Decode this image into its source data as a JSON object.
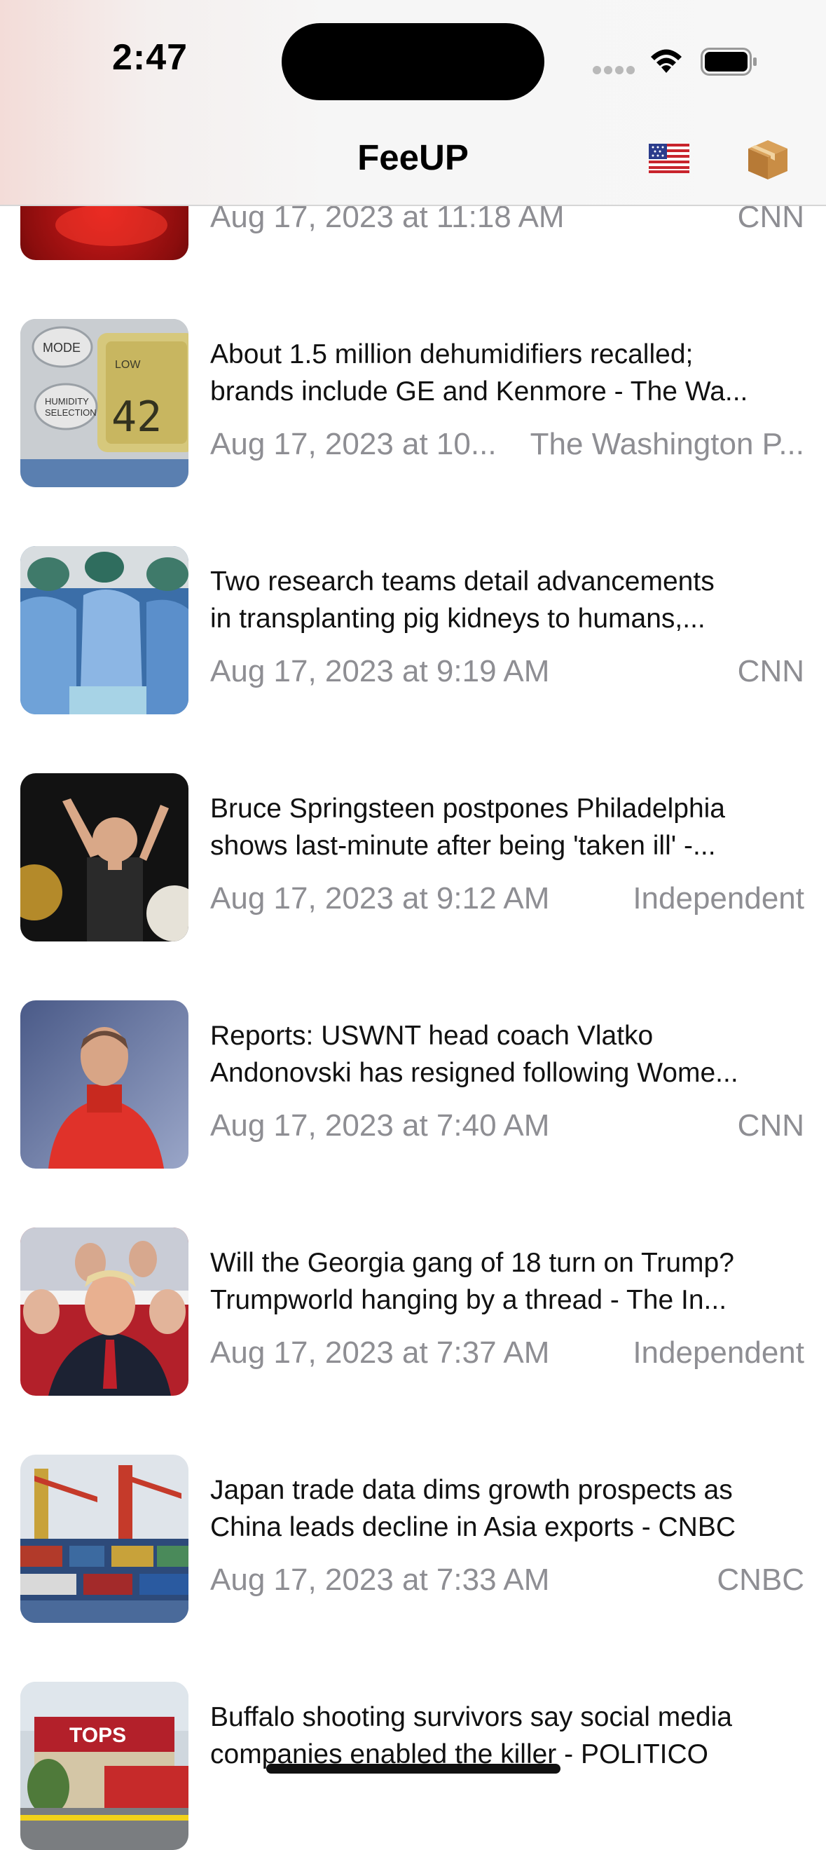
{
  "status_bar": {
    "time": "2:47"
  },
  "nav": {
    "title": "FeeUP",
    "flag_icon": "us-flag-icon",
    "box_icon": "package-icon"
  },
  "feed": [
    {
      "headline_lines": [],
      "date": "Aug 17, 2023 at 11:18 AM",
      "source": "CNN"
    },
    {
      "headline_lines": [
        "About 1.5 million dehumidifiers recalled;",
        "brands include GE and Kenmore - The Wa..."
      ],
      "date": "Aug 17, 2023 at 10...",
      "source": "The Washington P..."
    },
    {
      "headline_lines": [
        "Two research teams detail advancements",
        "in transplanting pig kidneys to humans,..."
      ],
      "date": "Aug 17, 2023 at 9:19 AM",
      "source": "CNN"
    },
    {
      "headline_lines": [
        "Bruce Springsteen postpones Philadelphia",
        "shows last-minute after being 'taken ill' -..."
      ],
      "date": "Aug 17, 2023 at 9:12 AM",
      "source": "Independent"
    },
    {
      "headline_lines": [
        "Reports: USWNT head coach Vlatko",
        "Andonovski has resigned following Wome..."
      ],
      "date": "Aug 17, 2023 at 7:40 AM",
      "source": "CNN"
    },
    {
      "headline_lines": [
        "Will the Georgia gang of 18 turn on Trump?",
        "Trumpworld hanging by a thread - The In..."
      ],
      "date": "Aug 17, 2023 at 7:37 AM",
      "source": "Independent"
    },
    {
      "headline_lines": [
        "Japan trade data dims growth prospects as",
        "China leads decline in Asia exports - CNBC"
      ],
      "date": "Aug 17, 2023 at 7:33 AM",
      "source": "CNBC"
    },
    {
      "headline_lines": [
        "Buffalo shooting survivors say social media",
        "companies enabled the killer - POLITICO"
      ],
      "date": "",
      "source": ""
    }
  ]
}
